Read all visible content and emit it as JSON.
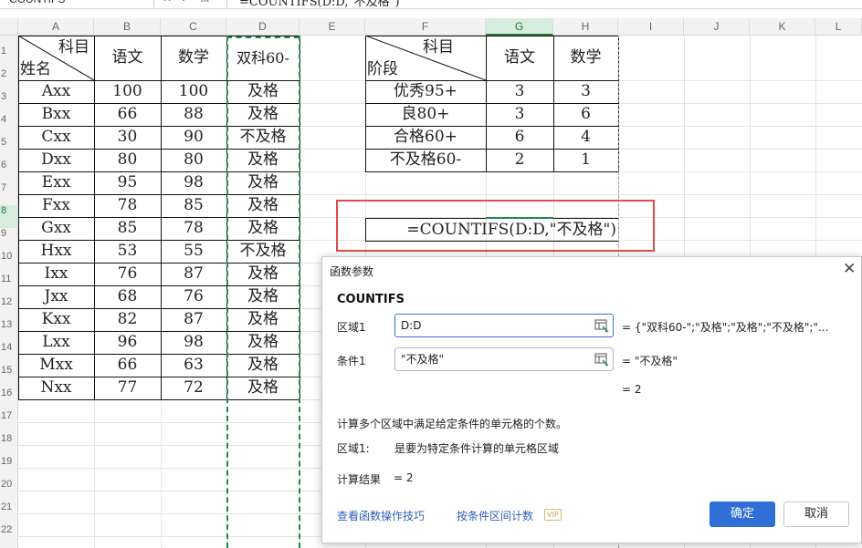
{
  "formula_bar": {
    "name_box": "COUNTIFS",
    "fx_label": "fx",
    "formula": "=COUNTIFS(D:D,\"不及格\")"
  },
  "columns": [
    "A",
    "B",
    "C",
    "D",
    "E",
    "F",
    "G",
    "H",
    "I",
    "J",
    "K",
    "L"
  ],
  "rows": [
    "1",
    "2",
    "3",
    "4",
    "5",
    "6",
    "7",
    "8",
    "9",
    "10",
    "11",
    "12",
    "13",
    "14",
    "15",
    "16",
    "17",
    "18",
    "19",
    "20",
    "21",
    "22"
  ],
  "table1": {
    "corner_top": "科目",
    "corner_bottom": "姓名",
    "headers": [
      "语文",
      "数学",
      "双科60-"
    ],
    "rows": [
      {
        "name": "Axx",
        "chinese": "100",
        "math": "100",
        "result": "及格"
      },
      {
        "name": "Bxx",
        "chinese": "66",
        "math": "88",
        "result": "及格"
      },
      {
        "name": "Cxx",
        "chinese": "30",
        "math": "90",
        "result": "不及格"
      },
      {
        "name": "Dxx",
        "chinese": "80",
        "math": "80",
        "result": "及格"
      },
      {
        "name": "Exx",
        "chinese": "95",
        "math": "98",
        "result": "及格"
      },
      {
        "name": "Fxx",
        "chinese": "78",
        "math": "85",
        "result": "及格"
      },
      {
        "name": "Gxx",
        "chinese": "85",
        "math": "78",
        "result": "及格"
      },
      {
        "name": "Hxx",
        "chinese": "53",
        "math": "55",
        "result": "不及格"
      },
      {
        "name": "Ixx",
        "chinese": "76",
        "math": "87",
        "result": "及格"
      },
      {
        "name": "Jxx",
        "chinese": "68",
        "math": "76",
        "result": "及格"
      },
      {
        "name": "Kxx",
        "chinese": "82",
        "math": "87",
        "result": "及格"
      },
      {
        "name": "Lxx",
        "chinese": "96",
        "math": "98",
        "result": "及格"
      },
      {
        "name": "Mxx",
        "chinese": "66",
        "math": "63",
        "result": "及格"
      },
      {
        "name": "Nxx",
        "chinese": "77",
        "math": "72",
        "result": "及格"
      }
    ]
  },
  "table2": {
    "corner_top": "科目",
    "corner_bottom": "阶段",
    "headers": [
      "语文",
      "数学"
    ],
    "rows": [
      {
        "stage": "优秀95+",
        "chinese": "3",
        "math": "3"
      },
      {
        "stage": "良80+",
        "chinese": "3",
        "math": "6"
      },
      {
        "stage": "合格60+",
        "chinese": "6",
        "math": "4"
      },
      {
        "stage": "不及格60-",
        "chinese": "2",
        "math": "1"
      }
    ]
  },
  "active_cell_formula": "=COUNTIFS(D:D,\"不及格\")",
  "dialog": {
    "title": "函数参数",
    "function_name": "COUNTIFS",
    "arg1_label": "区域1",
    "arg1_value": "D:D",
    "arg1_result": "= {\"双科60-\";\"及格\";\"及格\";\"不及格\";\"...",
    "arg2_label": "条件1",
    "arg2_value": "\"不及格\"",
    "arg2_result": "= \"不及格\"",
    "overall_result": "= 2",
    "description": "计算多个区域中满足给定条件的单元格的个数。",
    "arg_help_name": "区域1:",
    "arg_help_text": "是要为特定条件计算的单元格区域",
    "result_label": "计算结果",
    "result_value": "= 2",
    "link_tips": "查看函数操作技巧",
    "link_range_count": "按条件区间计数",
    "vip_badge": "VIP",
    "ok_label": "确定",
    "cancel_label": "取消",
    "close_glyph": "✕"
  },
  "colors": {
    "accent_green": "#1e8a4a",
    "primary_button": "#2f6fd6",
    "highlight_red": "#e14b4b"
  }
}
